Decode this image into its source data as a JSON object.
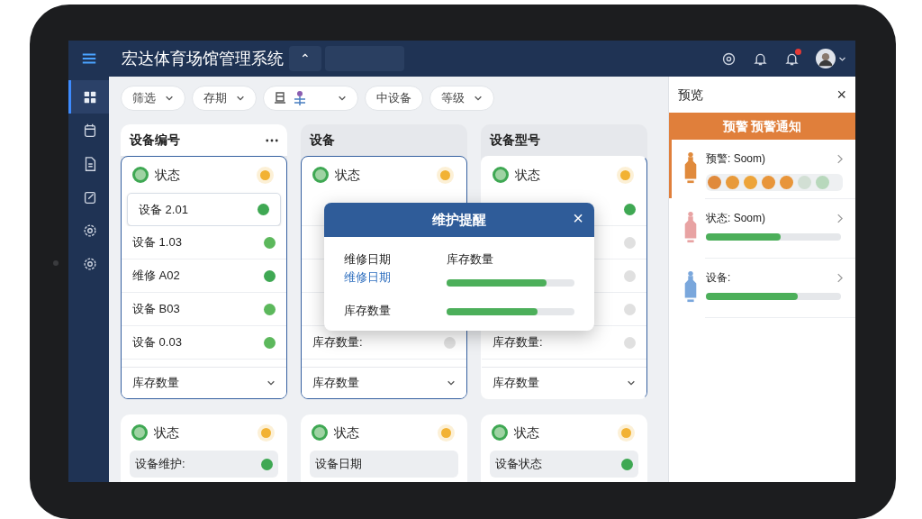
{
  "header": {
    "title": "宏达体育场馆管理系统",
    "chip": "⌃",
    "notification_badge": true
  },
  "sidebar": {
    "items": [
      {
        "selected": true
      },
      {
        "selected": false
      },
      {
        "selected": false
      },
      {
        "selected": false
      },
      {
        "selected": false
      },
      {
        "selected": false
      }
    ]
  },
  "filters": [
    {
      "kind": "text",
      "label": "筛选",
      "dropdown": true
    },
    {
      "kind": "text",
      "label": "存期",
      "dropdown": true
    },
    {
      "kind": "icon",
      "dropdown": true
    },
    {
      "kind": "text",
      "label": "中设备",
      "dropdown": false
    },
    {
      "kind": "text",
      "label": "等级",
      "dropdown": true
    }
  ],
  "columns": [
    {
      "title": "设备编号",
      "menu": true,
      "selected": true,
      "status_label": "状态",
      "footer": "库存数量",
      "rows": [
        {
          "label": "设备 2.01",
          "color": "#3fa853",
          "selected": true
        },
        {
          "label": "设备 1.03",
          "color": "#5cb85c",
          "selected": false
        },
        {
          "label": "维修 A02",
          "color": "#3fa853",
          "selected": false
        },
        {
          "label": "设备 B03",
          "color": "#5cb85c",
          "selected": false
        },
        {
          "label": "设备 0.03",
          "color": "#5cb85c",
          "selected": false
        }
      ]
    },
    {
      "title": "设备",
      "menu": false,
      "selected": true,
      "status_label": "状态",
      "footer": "库存数量",
      "rows": [
        {
          "selected": false
        },
        {
          "selected": false
        },
        {
          "selected": false
        },
        {
          "selected": false
        },
        {
          "label": "库存数量:",
          "color": "#e0e0e0",
          "selected": false
        }
      ]
    },
    {
      "title": "设备型号",
      "menu": false,
      "selected": false,
      "status_label": "状态",
      "footer": "库存数量",
      "rows": [
        {
          "color": "#3fa853",
          "selected": false
        },
        {
          "color": "#e0e0e0",
          "selected": false
        },
        {
          "color": "#e0e0e0",
          "selected": false
        },
        {
          "color": "#e0e0e0",
          "selected": false
        },
        {
          "label": "库存数量:",
          "color": "#e0e0e0",
          "selected": false
        }
      ]
    }
  ],
  "bottom_cards": [
    {
      "status_label": "状态",
      "row": {
        "label": "设备维护:",
        "color": "#3fa853"
      }
    },
    {
      "status_label": "状态",
      "row": {
        "label": "设备日期"
      }
    },
    {
      "status_label": "状态",
      "row": {
        "label": "设备状态",
        "color": "#3fa853"
      }
    }
  ],
  "preview_panel": {
    "title": "预览",
    "close": "×",
    "banner": "预警 预警通知",
    "items": [
      {
        "kind": "dots",
        "label": "预警: Soom)",
        "color": "#e08a3c",
        "selected": true,
        "dots": [
          {
            "color": "#e08a3c"
          },
          {
            "color": "#e89a3a"
          },
          {
            "color": "#eda43a"
          },
          {
            "color": "#e8953a"
          },
          {
            "color": "#e8953a"
          },
          {
            "color": "#d2dfd4"
          },
          {
            "color": "#b8d8bc"
          }
        ]
      },
      {
        "kind": "bar",
        "label": "状态: Soom)",
        "color": "#e8a3a3",
        "selected": false,
        "level": 0.55
      },
      {
        "kind": "bar",
        "label": "设备:",
        "color": "#7aa7dc",
        "selected": false,
        "level": 0.68
      }
    ]
  },
  "modal": {
    "title": "维护提醒",
    "close": "×",
    "left": [
      {
        "kind": "label",
        "text": "维修日期"
      },
      {
        "kind": "link",
        "text": "维修日期"
      },
      {
        "kind": "label",
        "text": "库存数量"
      }
    ],
    "right_label": "库存数量",
    "bars": [
      {
        "level": 0.78
      },
      {
        "level": 0.71
      }
    ]
  }
}
